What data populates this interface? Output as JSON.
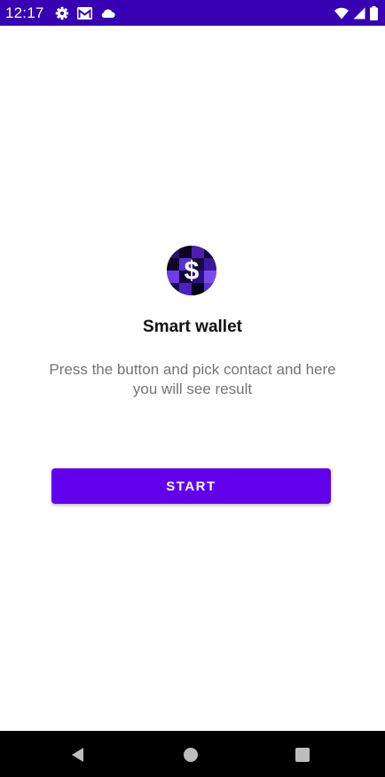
{
  "status_bar": {
    "time": "12:17",
    "left_icons": [
      "settings-icon",
      "gmail-icon",
      "cloud-icon"
    ],
    "right_icons": [
      "wifi-icon",
      "signal-icon",
      "battery-icon"
    ],
    "background_color": "#3700b3"
  },
  "main": {
    "logo_icon": "dollar-coin-icon",
    "title": "Smart wallet",
    "description": "Press the button and pick contact and here you will see result",
    "start_button_label": "START",
    "accent_color": "#6200ee"
  },
  "nav_bar": {
    "buttons": [
      "back-icon",
      "home-icon",
      "recents-icon"
    ]
  }
}
